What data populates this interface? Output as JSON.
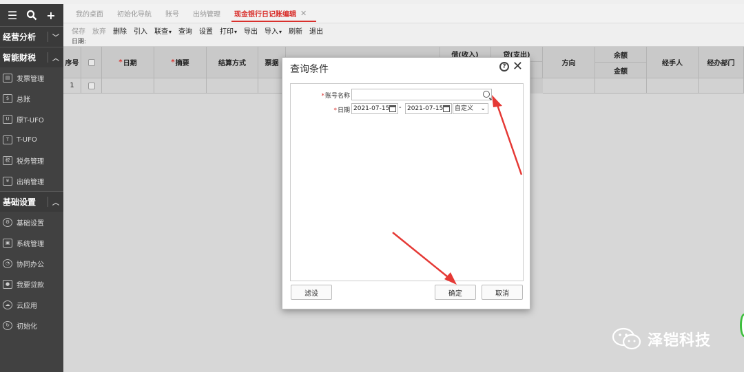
{
  "sidebar": {
    "sections": [
      {
        "label": "经营分析",
        "chevron": "chevron-down"
      },
      {
        "label": "智能财税",
        "chevron": "chevron-up"
      },
      {
        "label": "基础设置",
        "chevron": "chevron-up"
      }
    ],
    "finance_items": [
      {
        "label": "发票管理",
        "icon": "invoice-icon"
      },
      {
        "label": "总账",
        "icon": "ledger-icon"
      },
      {
        "label": "原T-UFO",
        "icon": "ufo-icon"
      },
      {
        "label": "T-UFO",
        "icon": "tufo-icon"
      },
      {
        "label": "税务管理",
        "icon": "tax-icon"
      },
      {
        "label": "出纳管理",
        "icon": "cashier-icon"
      }
    ],
    "basic_items": [
      {
        "label": "基础设置",
        "icon": "gear-icon"
      },
      {
        "label": "系统管理",
        "icon": "system-icon"
      },
      {
        "label": "协同办公",
        "icon": "collab-icon"
      },
      {
        "label": "我要贷款",
        "icon": "loan-icon"
      },
      {
        "label": "云应用",
        "icon": "cloud-icon"
      },
      {
        "label": "初始化",
        "icon": "init-icon"
      }
    ]
  },
  "tabs": [
    {
      "label": "我的桌面"
    },
    {
      "label": "初始化导航"
    },
    {
      "label": "账号"
    },
    {
      "label": "出纳管理"
    },
    {
      "label": "现金银行日记账编辑",
      "active": true
    }
  ],
  "toolbar": {
    "save": "保存",
    "discard": "放弃",
    "delete": "删除",
    "import_in": "引入",
    "link_query": "联查",
    "query": "查询",
    "settings": "设置",
    "print": "打印",
    "export": "导出",
    "import": "导入",
    "refresh": "刷新",
    "exit": "退出"
  },
  "date_label": "日期:",
  "grid": {
    "headers": {
      "seq": "序号",
      "date": "日期",
      "summary": "摘要",
      "settle": "结算方式",
      "bill": "票据",
      "debit": "借(收入)",
      "credit": "贷(支出)",
      "direction": "方向",
      "balance": "余额",
      "amount": "金额",
      "handler": "经手人",
      "dept": "经办部门"
    },
    "rows": [
      {
        "seq": "1"
      }
    ]
  },
  "dialog": {
    "title": "查询条件",
    "account_label": "账号名称",
    "account_value": "",
    "date_label": "日期",
    "date_from": "2021-07-15",
    "date_sep": "-",
    "date_to": "2021-07-15",
    "period": "自定义",
    "filter_btn": "滤设",
    "ok_btn": "确定",
    "cancel_btn": "取消"
  },
  "watermark": {
    "name": "泽铠科技"
  },
  "colors": {
    "accent": "#d9302c",
    "sidebar": "#414141",
    "arrow": "#e53935"
  }
}
